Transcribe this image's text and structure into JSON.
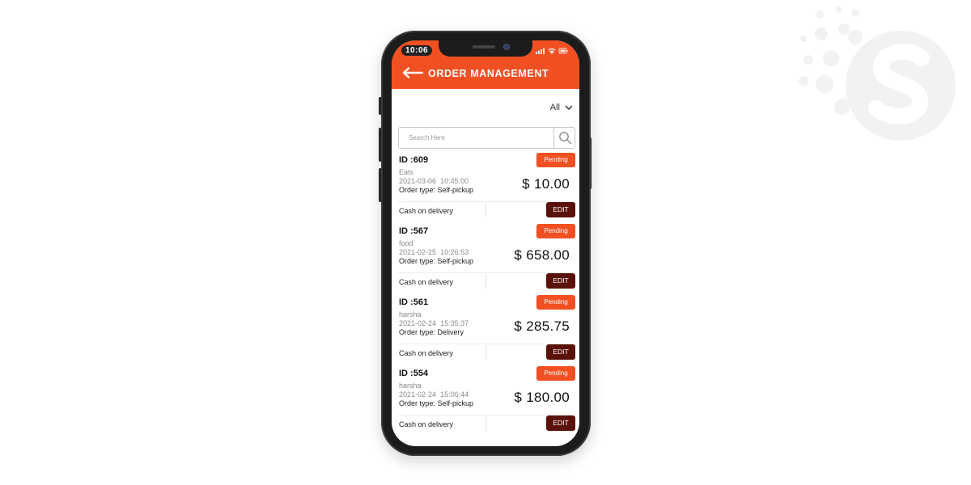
{
  "status_bar": {
    "time": "10:06"
  },
  "header": {
    "title": "ORDER MANAGEMENT"
  },
  "filter": {
    "selected": "All"
  },
  "search": {
    "placeholder": "Search Here",
    "value": ""
  },
  "colors": {
    "accent": "#f25022",
    "edit": "#5a1208"
  },
  "orders": [
    {
      "id": "ID :609",
      "status": "Pending",
      "customer": "Eats",
      "date": "2021-03-06",
      "time": "10:45:00",
      "order_type": "Order type: Self-pickup",
      "amount": "$ 10.00",
      "payment": "Cash on delivery",
      "edit_label": "EDIT"
    },
    {
      "id": "ID :567",
      "status": "Pending",
      "customer": "food",
      "date": "2021-02-25",
      "time": "10:26:53",
      "order_type": "Order type: Self-pickup",
      "amount": "$ 658.00",
      "payment": "Cash on delivery",
      "edit_label": "EDIT"
    },
    {
      "id": "ID :561",
      "status": "Pending",
      "customer": "harsha",
      "date": "2021-02-24",
      "time": "15:35:37",
      "order_type": "Order type: Delivery",
      "amount": "$ 285.75",
      "payment": "Cash on delivery",
      "edit_label": "EDIT"
    },
    {
      "id": "ID :554",
      "status": "Pending",
      "customer": "harsha",
      "date": "2021-02-24",
      "time": "15:06:44",
      "order_type": "Order type: Self-pickup",
      "amount": "$ 180.00",
      "payment": "Cash on delivery",
      "edit_label": "EDIT"
    }
  ]
}
